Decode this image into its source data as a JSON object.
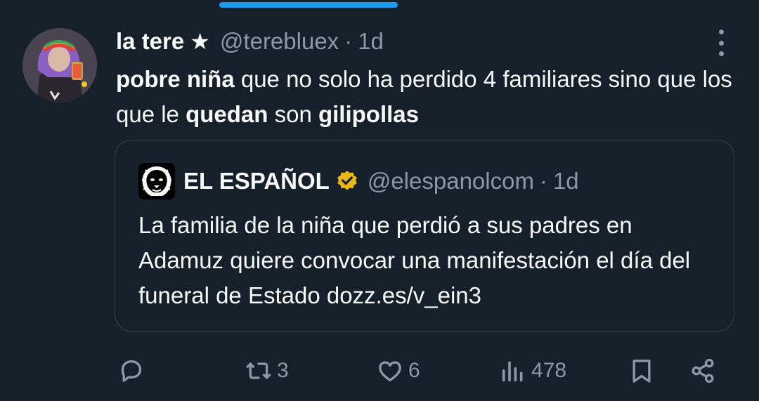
{
  "tweet": {
    "display_name": "la tere",
    "badge_glyph": "★",
    "handle": "@terebluex",
    "separator": "·",
    "time": "1d",
    "text_parts": [
      {
        "text": "pobre niña",
        "bold": true
      },
      {
        "text": " que no solo ha perdido 4 familiares sino que los que le ",
        "bold": false
      },
      {
        "text": "quedan",
        "bold": true
      },
      {
        "text": " son ",
        "bold": false
      },
      {
        "text": "gilipollas",
        "bold": true
      }
    ]
  },
  "quote": {
    "display_name": "EL ESPAÑOL",
    "handle": "@elespanolcom",
    "separator": "·",
    "time": "1d",
    "text": "La familia de la niña que perdió a sus padres en Adamuz quiere convocar una manifestación el día del funeral de Estado dozz.es/v_ein3",
    "verified_color": "#e8b71a"
  },
  "actions": {
    "reply_count": "",
    "retweet_count": "3",
    "like_count": "6",
    "view_count": "478"
  },
  "icons": {
    "more": "more-vertical-icon",
    "reply": "reply-icon",
    "retweet": "retweet-icon",
    "like": "heart-icon",
    "views": "views-icon",
    "bookmark": "bookmark-icon",
    "share": "share-icon"
  },
  "colors": {
    "background": "#15202b",
    "text": "#f7f9f9",
    "muted": "#8b98a5",
    "border": "#38444d",
    "accent": "#1d9bf0"
  }
}
